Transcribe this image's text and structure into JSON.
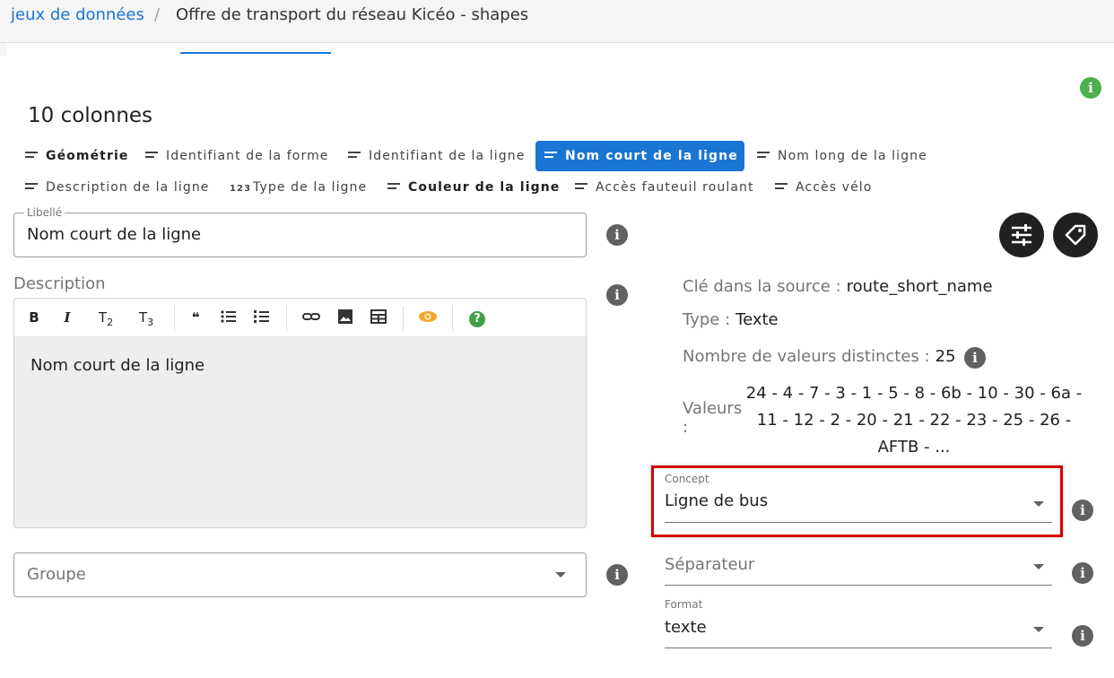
{
  "breadcrumb": {
    "link": "jeux de données",
    "separator": "/",
    "current": "Offre de transport du réseau Kicéo - shapes"
  },
  "info_icon": "i",
  "title": "10 colonnes",
  "columns": [
    {
      "label": "Géométrie",
      "type": "text"
    },
    {
      "label": "Identifiant de la forme",
      "type": "text"
    },
    {
      "label": "Identifiant de la ligne",
      "type": "text"
    },
    {
      "label": "Nom court de la ligne",
      "type": "text"
    },
    {
      "label": "Nom long de la ligne",
      "type": "text"
    },
    {
      "label": "Description de la ligne",
      "type": "text"
    },
    {
      "label": "Type de la ligne",
      "type": "number",
      "icon_text": "123"
    },
    {
      "label": "Couleur de la ligne",
      "type": "text"
    },
    {
      "label": "Accès fauteuil roulant",
      "type": "text"
    },
    {
      "label": "Accès vélo",
      "type": "text"
    }
  ],
  "libelle": {
    "legend": "Libellé",
    "value": "Nom court de la ligne"
  },
  "description": {
    "label": "Description",
    "content": "Nom court de la ligne",
    "toolbar": {
      "bold": "B",
      "italic": "I",
      "t2": "T",
      "t2_sub": "2",
      "t3": "T",
      "t3_sub": "3",
      "quote": "❝",
      "help": "?"
    }
  },
  "groupe": {
    "placeholder": "Groupe"
  },
  "properties": {
    "source_key_label": "Clé dans la source :",
    "source_key_value": "route_short_name",
    "type_label": "Type :",
    "type_value": "Texte",
    "distinct_label": "Nombre de valeurs distinctes :",
    "distinct_value": "25",
    "values_label": "Valeurs",
    "values_colon": ":",
    "values_text": "24 - 4 - 7 - 3 - 1 - 5 - 8 - 6b - 10 - 30 - 6a - 11 - 12 - 2 - 20 - 21 - 22 - 23 - 25 - 26 - AFTB - ..."
  },
  "concept": {
    "legend": "Concept",
    "value": "Ligne de bus"
  },
  "separateur": {
    "placeholder": "Séparateur"
  },
  "format": {
    "legend": "Format",
    "value": "texte"
  },
  "colors": {
    "accent": "#1976d2",
    "highlight": "#d50000",
    "info_green": "#4caf50",
    "eye_orange": "#f5a623",
    "help_green": "#43a047"
  }
}
